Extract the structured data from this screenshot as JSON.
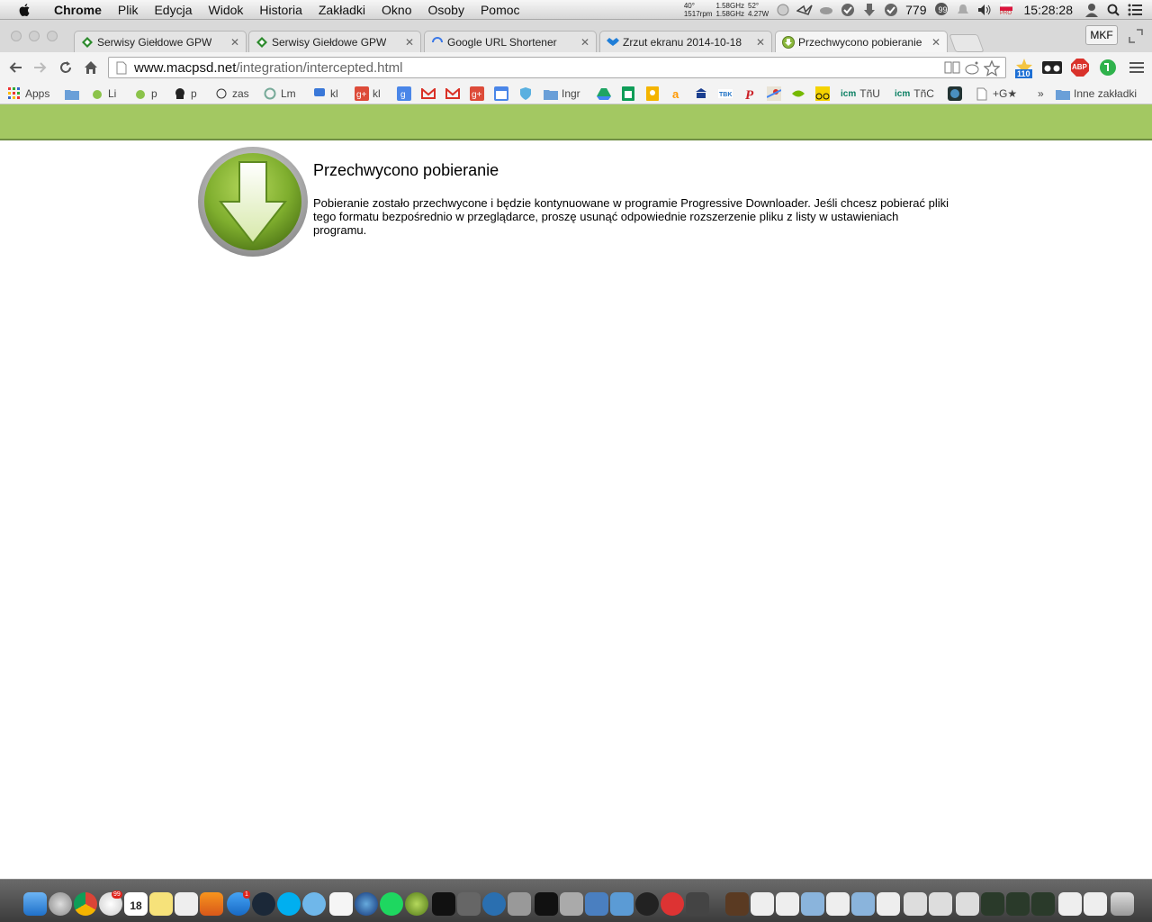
{
  "menubar": {
    "app_name": "Chrome",
    "menus": [
      "Plik",
      "Edycja",
      "Widok",
      "Historia",
      "Zakładki",
      "Okno",
      "Osoby",
      "Pomoc"
    ],
    "stats_left": "40°\n1517rpm",
    "stats_mid": "1.58GHz\n1.58GHz",
    "stats_right": "52°\n4.27W",
    "counter": "779",
    "flag_label": "PRO",
    "clock": "15:28:28"
  },
  "tabs": [
    {
      "title": "Serwisy Giełdowe GPW",
      "icon": "gpw-icon"
    },
    {
      "title": "Serwisy Giełdowe GPW",
      "icon": "gpw-icon"
    },
    {
      "title": "Google URL Shortener",
      "icon": "loading-spinner-icon"
    },
    {
      "title": "Zrzut ekranu 2014-10-18",
      "icon": "dropbox-icon"
    },
    {
      "title": "Przechwycono pobieranie",
      "icon": "download-icon"
    }
  ],
  "profile_label": "MKF",
  "address": {
    "host": "www.macpsd.net",
    "path": "/integration/intercepted.html"
  },
  "extensions": {
    "badge_count": "110",
    "abp_label": "ABP"
  },
  "bookmarks": {
    "apps": "Apps",
    "items": [
      "Li",
      "p",
      "p",
      "zas",
      "Lm",
      "kl",
      "kl",
      "Ingr",
      "TñU",
      "TñC",
      "+G★"
    ],
    "icm": "icm",
    "overflow": "»",
    "other": "Inne zakładki"
  },
  "page": {
    "heading": "Przechwycono pobieranie",
    "message": "Pobieranie zostało przechwycone i będzie kontynuowane w programie Progressive Downloader. Jeśli chcesz pobierać pliki tego formatu bezpośrednio w przeglądarce, proszę usunąć odpowiednie rozszerzenie pliku z listy w ustawieniach programu."
  },
  "dock": {
    "calendar_day": "18",
    "badges": [
      "99",
      "1"
    ]
  },
  "colors": {
    "green_band": "#a3c862",
    "logo_green": "#7fae2e"
  }
}
